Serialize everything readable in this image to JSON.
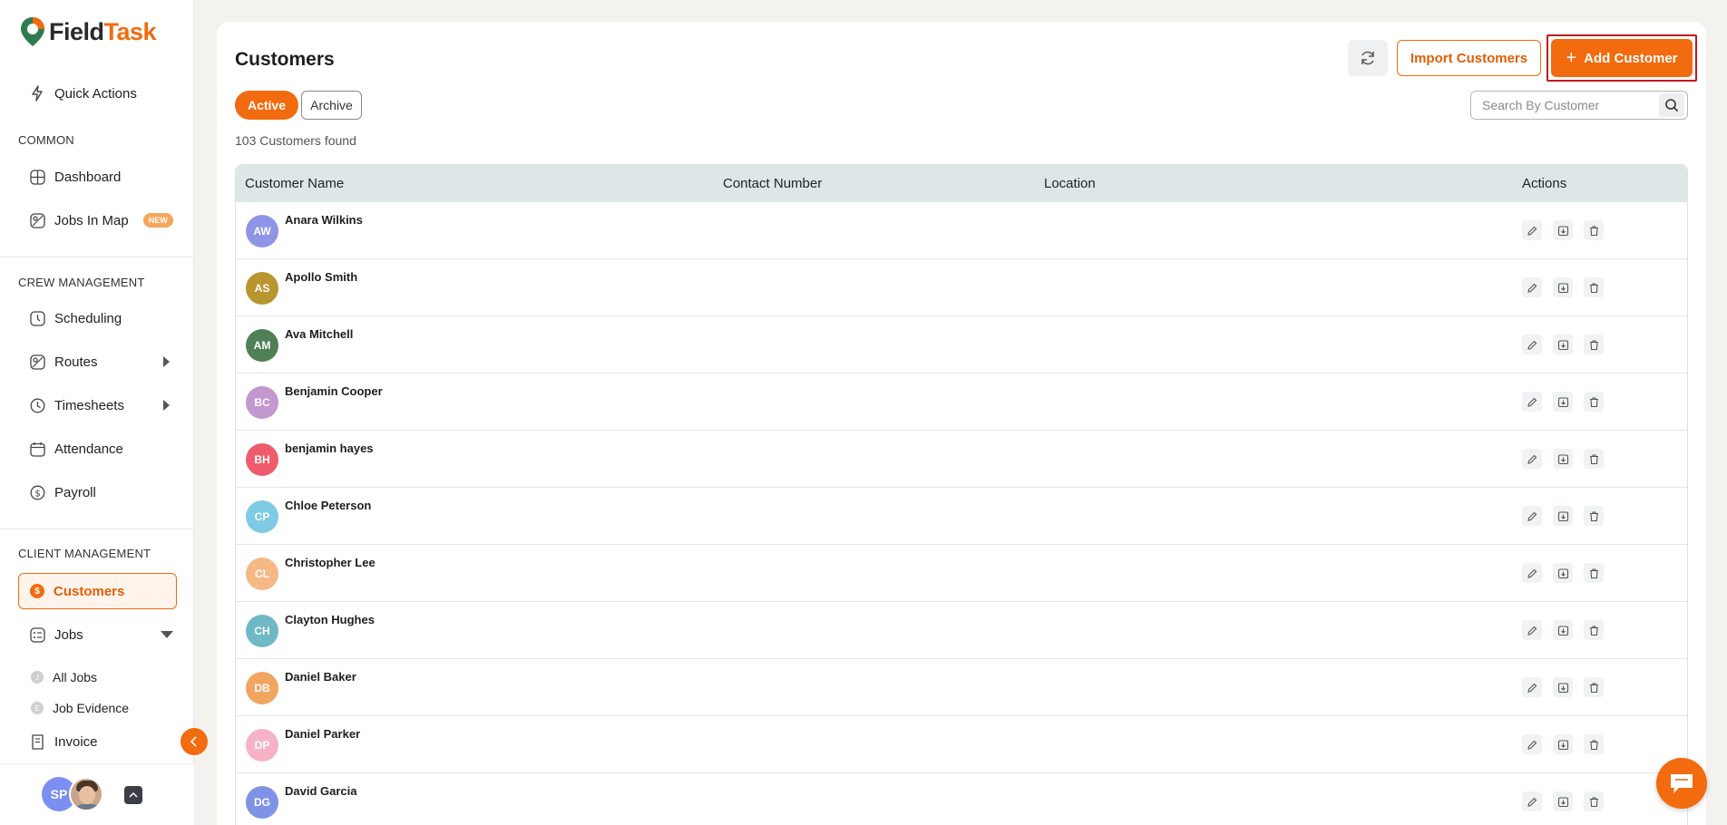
{
  "brand": {
    "name_a": "Field",
    "name_b": "Task",
    "accent": "#f26b0f"
  },
  "sidebar": {
    "quick_actions": "Quick Actions",
    "common_label": "COMMON",
    "dashboard": "Dashboard",
    "jobs_in_map": "Jobs In Map",
    "new_badge": "NEW",
    "crew_label": "CREW MANAGEMENT",
    "scheduling": "Scheduling",
    "routes": "Routes",
    "timesheets": "Timesheets",
    "attendance": "Attendance",
    "payroll": "Payroll",
    "client_label": "CLIENT MANAGEMENT",
    "customers": "Customers",
    "jobs": "Jobs",
    "all_jobs": "All Jobs",
    "all_jobs_dot": "J",
    "job_evidence": "Job Evidence",
    "job_evidence_dot": "E",
    "invoice": "Invoice",
    "user_initials": "SP"
  },
  "main": {
    "title": "Customers",
    "import_label": "Import Customers",
    "add_label": "Add Customer",
    "tab_active": "Active",
    "tab_archive": "Archive",
    "search_placeholder": "Search By Customer",
    "count_text": "103 Customers found",
    "columns": {
      "name": "Customer Name",
      "contact": "Contact Number",
      "location": "Location",
      "actions": "Actions"
    },
    "rows": [
      {
        "initials": "AW",
        "name": "Anara Wilkins",
        "color": "#8f95e6"
      },
      {
        "initials": "AS",
        "name": "Apollo Smith",
        "color": "#b8952e"
      },
      {
        "initials": "AM",
        "name": "Ava Mitchell",
        "color": "#4f7f55"
      },
      {
        "initials": "BC",
        "name": "Benjamin Cooper",
        "color": "#c397cf"
      },
      {
        "initials": "BH",
        "name": "benjamin hayes",
        "color": "#ef5b6c"
      },
      {
        "initials": "CP",
        "name": "Chloe Peterson",
        "color": "#7fcbe6"
      },
      {
        "initials": "CL",
        "name": "Christopher Lee",
        "color": "#f5b986"
      },
      {
        "initials": "CH",
        "name": "Clayton Hughes",
        "color": "#6fb9c4"
      },
      {
        "initials": "DB",
        "name": "Daniel Baker",
        "color": "#f2a55f"
      },
      {
        "initials": "DP",
        "name": "Daniel Parker",
        "color": "#f7b3c6"
      },
      {
        "initials": "DG",
        "name": "David Garcia",
        "color": "#7f93e6"
      }
    ]
  }
}
